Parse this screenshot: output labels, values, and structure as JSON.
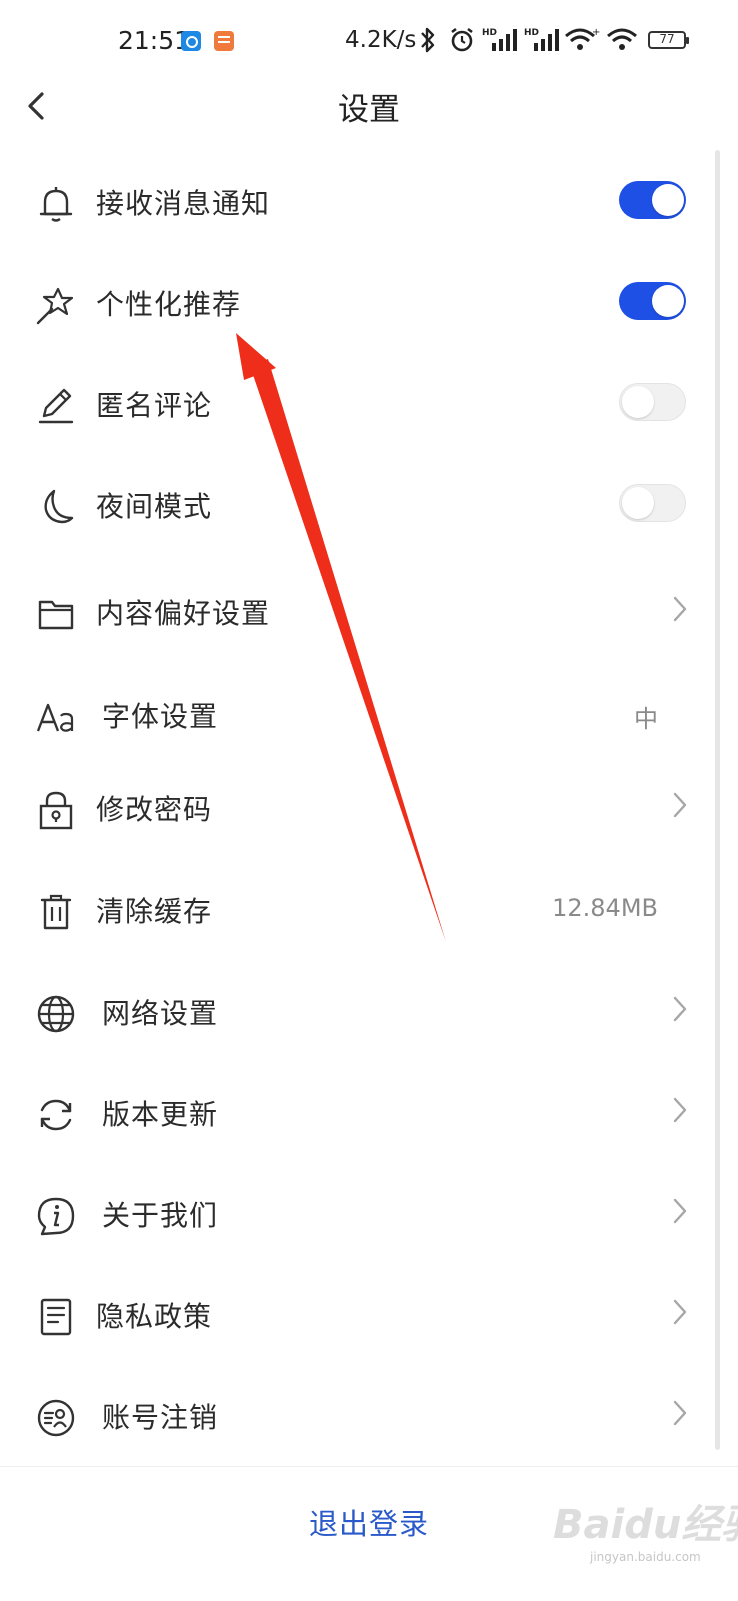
{
  "status_bar": {
    "time": "21:51",
    "net_speed": "4.2K/s",
    "battery": "77",
    "icons": [
      "app-notification-icon",
      "app-notification-icon",
      "bluetooth-icon",
      "alarm-icon",
      "hd-signal-icon",
      "hd-signal-icon",
      "wifi-icon",
      "wifi-icon",
      "battery-icon"
    ]
  },
  "nav": {
    "title": "设置",
    "back_icon": "chevron-left-icon"
  },
  "settings": [
    {
      "label": "接收消息通知",
      "icon": "bell-icon",
      "control": "toggle",
      "on": true
    },
    {
      "label": "个性化推荐",
      "icon": "magic-wand-icon",
      "control": "toggle",
      "on": true
    },
    {
      "label": "匿名评论",
      "icon": "pencil-icon",
      "control": "toggle",
      "on": false
    },
    {
      "label": "夜间模式",
      "icon": "moon-icon",
      "control": "toggle",
      "on": false
    },
    {
      "label": "内容偏好设置",
      "icon": "folder-icon",
      "control": "chevron"
    },
    {
      "label": "字体设置",
      "icon": "font-aa-icon",
      "control": "value",
      "value": "中"
    },
    {
      "label": "修改密码",
      "icon": "lock-icon",
      "control": "chevron"
    },
    {
      "label": "清除缓存",
      "icon": "trash-icon",
      "control": "value",
      "value": "12.84MB"
    },
    {
      "label": "网络设置",
      "icon": "globe-icon",
      "control": "chevron"
    },
    {
      "label": "版本更新",
      "icon": "refresh-icon",
      "control": "chevron"
    },
    {
      "label": "关于我们",
      "icon": "info-icon",
      "control": "chevron"
    },
    {
      "label": "隐私政策",
      "icon": "document-icon",
      "control": "chevron"
    },
    {
      "label": "账号注销",
      "icon": "account-cancel-icon",
      "control": "chevron"
    }
  ],
  "logout_label": "退出登录",
  "colors": {
    "accent": "#1f50e5",
    "logout_text": "#2a59c9",
    "annotation_arrow": "#ee2e1a"
  },
  "watermark": {
    "text": "Baidu经验",
    "sub": "jingyan.baidu.com"
  }
}
